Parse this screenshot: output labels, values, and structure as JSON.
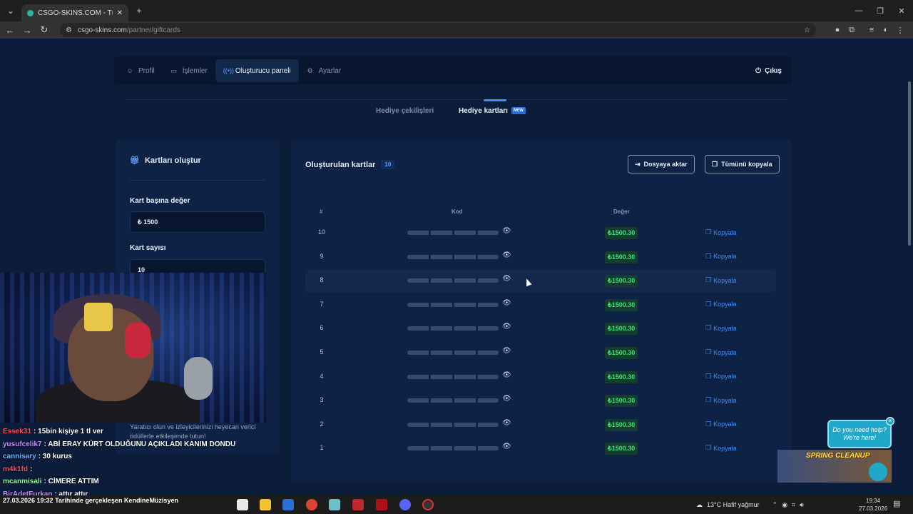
{
  "browser": {
    "tab_title": "CSGO-SKINS.COM - Türkiye'nin",
    "url_host": "csgo-skins.com",
    "url_path": "/partner/giftcards"
  },
  "nav": {
    "items": [
      {
        "label": "Profil",
        "icon": "user-icon"
      },
      {
        "label": "İşlemler",
        "icon": "wallet-icon"
      },
      {
        "label": "Oluşturucu paneli",
        "icon": "broadcast-icon",
        "active": true
      },
      {
        "label": "Ayarlar",
        "icon": "gear-icon"
      }
    ],
    "logout": "Çıkış"
  },
  "subtabs": {
    "raffles": "Hediye çekilişleri",
    "giftcards": "Hediye kartları",
    "new_badge": "NEW"
  },
  "create": {
    "title": "Kartları oluştur",
    "value_label": "Kart başına değer",
    "value": "₺ 1500",
    "count_label": "Kart sayısı",
    "count": "10",
    "footer": "Yaratıcı olun ve izleyicilerinizi heyecan verici ödüllerle etkileşimde tutun!"
  },
  "cards": {
    "title": "Oluşturulan kartlar",
    "count": "10",
    "export_label": "Dosyaya aktar",
    "copy_all_label": "Tümünü kopyala",
    "headers": {
      "num": "#",
      "code": "Kod",
      "value": "Değer"
    },
    "copy_label": "Kopyala",
    "rows": [
      {
        "num": "10",
        "value": "₺1500.30"
      },
      {
        "num": "9",
        "value": "₺1500.30"
      },
      {
        "num": "8",
        "value": "₺1500.30"
      },
      {
        "num": "7",
        "value": "₺1500.30"
      },
      {
        "num": "6",
        "value": "₺1500.30"
      },
      {
        "num": "5",
        "value": "₺1500.30"
      },
      {
        "num": "4",
        "value": "₺1500.30"
      },
      {
        "num": "3",
        "value": "₺1500.30"
      },
      {
        "num": "2",
        "value": "₺1500.30"
      },
      {
        "num": "1",
        "value": "₺1500.30"
      }
    ]
  },
  "chat": [
    {
      "user": "Essek31",
      "color": "#ff4a5a",
      "msg": ": 15bin kişiye 1 tl ver"
    },
    {
      "user": "yusufcelik7",
      "color": "#c58cff",
      "msg": ": ABİ ERAY KÜRT OLDUĞUNU AÇIKLADI KANIM DONDU"
    },
    {
      "user": "cannisary",
      "color": "#6ab0ff",
      "msg": ": 30 kurus"
    },
    {
      "user": "m4k1fd",
      "color": "#ff4a5a",
      "msg": ":"
    },
    {
      "user": "mcanmisali",
      "color": "#9bf0a0",
      "msg": ": CİMERE ATTIM"
    },
    {
      "user": "BirAdetFurkan",
      "color": "#c58cff",
      "msg": ": attır attır"
    }
  ],
  "ticker": "27.03.2026 19:32 Tarihinde gerçekleşen KendineMüzisyen",
  "help": {
    "text": "Do you need help? We're here!",
    "close": "×"
  },
  "promo": {
    "text": "SPRING CLEANUP"
  },
  "taskbar": {
    "weather": "13°C  Hafif yağmur",
    "time": "19:34",
    "date": "27.03.2026"
  }
}
